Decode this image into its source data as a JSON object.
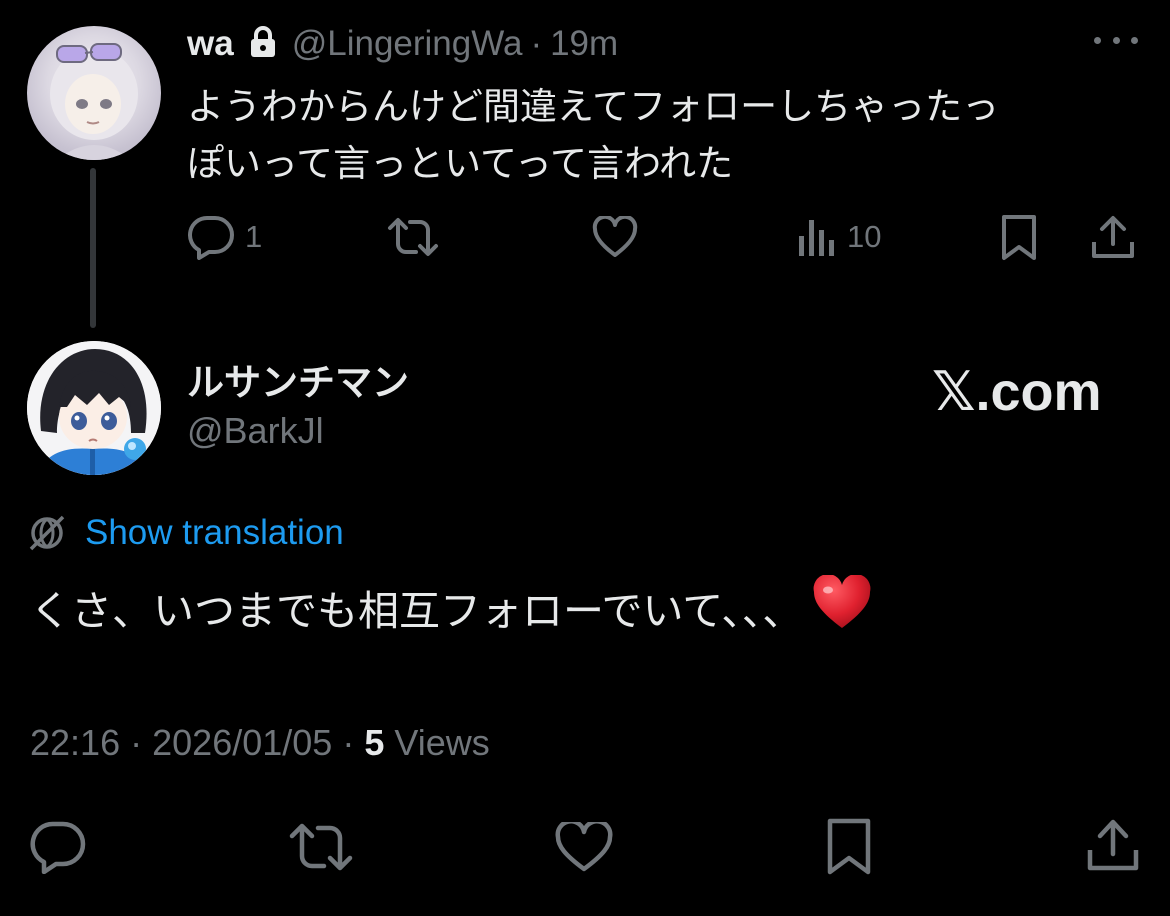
{
  "parent_tweet": {
    "display_name": "wa",
    "handle": "@LingeringWa",
    "separator": "·",
    "time": "19m",
    "text_line1": "ようわからんけど間違えてフォローしちゃったっ",
    "text_line2": "ぽいって言っといてって言われた",
    "reply_count": "1",
    "views_count": "10",
    "icons": [
      "lock-icon",
      "more-icon",
      "reply-icon",
      "retweet-icon",
      "like-icon",
      "views-icon",
      "bookmark-icon",
      "share-icon"
    ]
  },
  "main_tweet": {
    "display_name": "ルサンチマン",
    "handle": "@BarkJl",
    "watermark": "𝕏.com",
    "translation_link": "Show translation",
    "text": "くさ、いつまでも相互フォローでいて、、、",
    "time": "22:16",
    "separator": "·",
    "date": "2026/01/05",
    "views_count": "5",
    "views_label": "Views",
    "icons": [
      "globe-icon",
      "heart-emoji-icon",
      "reply-icon",
      "retweet-icon",
      "like-icon",
      "bookmark-icon",
      "share-icon"
    ]
  },
  "colors": {
    "background": "#000000",
    "primary_text": "#e7e9ea",
    "secondary_text": "#71767b",
    "link": "#1d9bf0",
    "thread_line": "#333639",
    "heart_emoji": "#e0212f"
  }
}
